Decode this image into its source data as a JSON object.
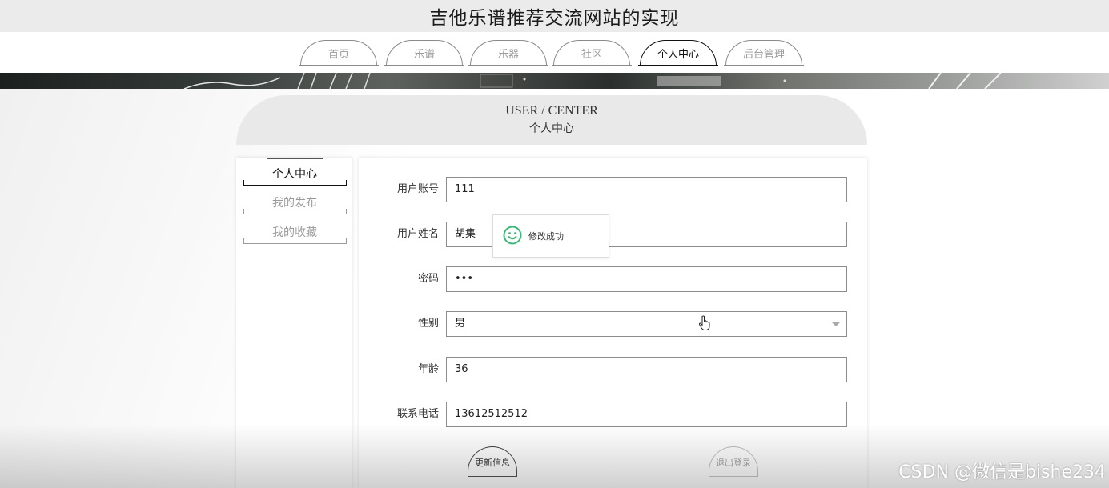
{
  "site": {
    "title": "吉他乐谱推荐交流网站的实现"
  },
  "nav": {
    "items": [
      {
        "label": "首页"
      },
      {
        "label": "乐谱"
      },
      {
        "label": "乐器"
      },
      {
        "label": "社区"
      },
      {
        "label": "个人中心",
        "active": true
      },
      {
        "label": "后台管理"
      }
    ]
  },
  "header": {
    "title_en": "USER / CENTER",
    "title_cn": "个人中心"
  },
  "sidebar": {
    "items": [
      {
        "label": "个人中心",
        "active": true
      },
      {
        "label": "我的发布"
      },
      {
        "label": "我的收藏"
      }
    ]
  },
  "form": {
    "account": {
      "label": "用户账号",
      "value": "111"
    },
    "name": {
      "label": "用户姓名",
      "value": "胡集"
    },
    "password": {
      "label": "密码",
      "value": "•••"
    },
    "gender": {
      "label": "性别",
      "value": "男"
    },
    "age": {
      "label": "年龄",
      "value": "36"
    },
    "phone": {
      "label": "联系电话",
      "value": "13612512512"
    }
  },
  "buttons": {
    "update": "更新信息",
    "logout": "退出登录"
  },
  "toast": {
    "message": "修改成功",
    "icon": "smile-icon",
    "color": "#3cb878"
  },
  "watermark": "CSDN @微信是bishe234"
}
